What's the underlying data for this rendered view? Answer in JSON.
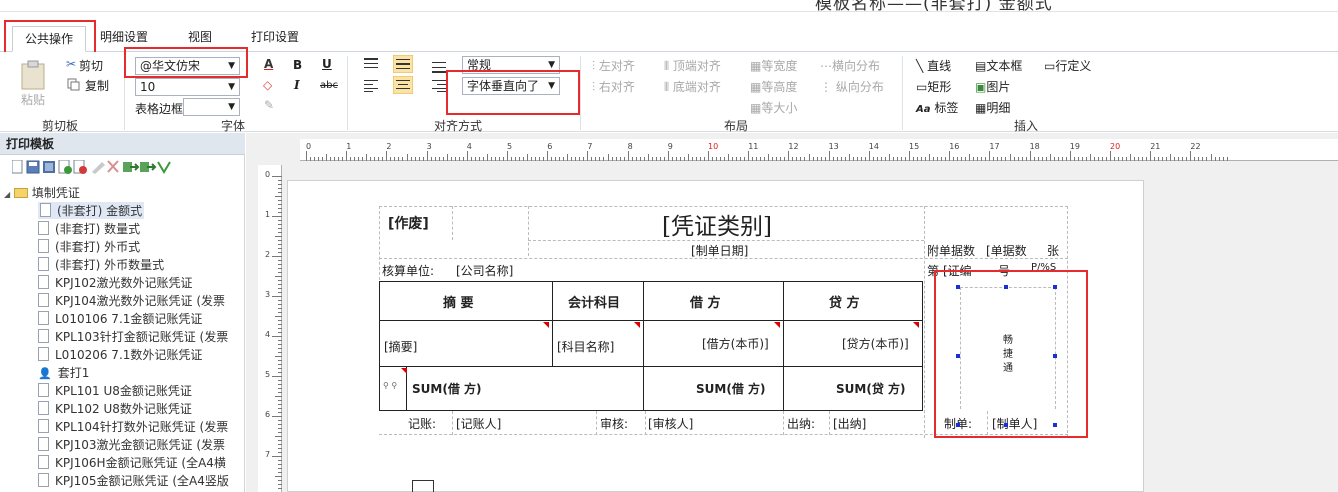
{
  "window": {
    "title": "模板名称——(非套打) 金额式"
  },
  "tabs": [
    "公共操作",
    "明细设置",
    "视图",
    "打印设置"
  ],
  "clipboard": {
    "paste": "粘贴",
    "cut": "剪切",
    "copy": "复制",
    "group": "剪切板"
  },
  "font": {
    "family": "@华文仿宋",
    "size": "10",
    "border_label": "表格边框",
    "border_value": "",
    "group": "字体",
    "bold": "B",
    "italic": "I",
    "underline": "U",
    "strike": "abc"
  },
  "align": {
    "style": "常规",
    "vertical": "字体垂直向了",
    "group": "对齐方式"
  },
  "layout": {
    "left": "左对齐",
    "right": "右对齐",
    "top": "顶端对齐",
    "bottom": "底端对齐",
    "eqwidth": "等宽度",
    "eqheight": "等高度",
    "eqsize": "等大小",
    "hdist": "横向分布",
    "vdist": "纵向分布",
    "group": "布局"
  },
  "insert": {
    "line": "直线",
    "rect": "矩形",
    "label": "标签",
    "textbox": "文本框",
    "image": "图片",
    "detail": "明细",
    "rowdef": "行定义",
    "group": "插入"
  },
  "panel": {
    "title": "打印模板",
    "root": "填制凭证",
    "items": [
      "(非套打) 金额式",
      "(非套打) 数量式",
      "(非套打) 外币式",
      "(非套打) 外币数量式",
      "KPJ102激光数外记账凭证",
      "KPJ104激光数外记账凭证 (发票",
      "L010106 7.1金额记账凭证",
      "KPL103针打金额记账凭证 (发票",
      "L010206 7.1数外记账凭证",
      "套打1",
      "KPL101 U8金额记账凭证",
      "KPL102 U8数外记账凭证",
      "KPL104针打数外记账凭证 (发票",
      "KPJ103激光金额记账凭证 (发票",
      "KPJ106H金额记账凭证 (全A4横",
      "KPJ105金额记账凭证 (全A4竖版"
    ]
  },
  "ruler_h": [
    "0",
    "1",
    "2",
    "3",
    "4",
    "5",
    "6",
    "7",
    "8",
    "9",
    "10",
    "11",
    "12",
    "13",
    "14",
    "15",
    "16",
    "17",
    "18",
    "19",
    "20",
    "21",
    "22"
  ],
  "ruler_v": [
    "0",
    "1",
    "2",
    "3",
    "4",
    "5",
    "6",
    "7"
  ],
  "voucher": {
    "void": "[作废]",
    "title": "[凭证类别]",
    "date": "[制单日期]",
    "attach": "附单据数",
    "attach2": "[单据数",
    "zhang": "张",
    "di": "第",
    "voucher_no": "[证编",
    "hao": "号—",
    "page_tag": "P/%S",
    "unit_label": "核算单位:",
    "unit_value": "[公司名称]",
    "col_summary": "摘    要",
    "col_account": "会计科目",
    "col_debit": "借    方",
    "col_credit": "贷    方",
    "row_summary": "[摘要]",
    "row_account": "[科目名称]",
    "row_debit": "[借方(本币)]",
    "row_credit": "[贷方(本币)]",
    "sum_label": "SUM(借    方)",
    "sum_debit": "SUM(借    方)",
    "sum_credit": "SUM(贷    方)",
    "bookkeeper_label": "记账:",
    "bookkeeper": "[记账人]",
    "auditor_label": "审核:",
    "auditor": "[审核人]",
    "cashier_label": "出纳:",
    "cashier": "[出纳]",
    "maker_label": "制单:",
    "maker": "[制单人]",
    "logo_text": [
      "畅",
      "捷",
      "通"
    ]
  },
  "colors": {
    "highlight": "#e52b2b",
    "handle": "#1a2fd8",
    "panel_head": "#dfe6ee"
  }
}
